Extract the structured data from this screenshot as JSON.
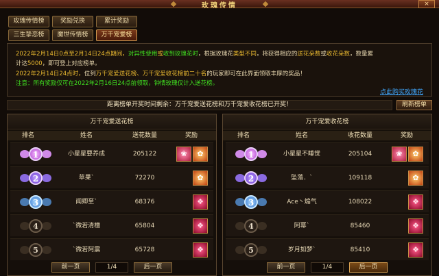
{
  "window": {
    "title": "玫瑰传情",
    "close_label": "×"
  },
  "tabs_main": [
    "玫瑰传情榜",
    "奖励兑换",
    "累计奖励"
  ],
  "tabs_sub": [
    "三生挚恋榜",
    "魔世传情榜",
    "万千宠爱榜"
  ],
  "info": {
    "line1": [
      {
        "t": "2022年2月14日0点至2月14日24点期间，",
        "c": "y"
      },
      {
        "t": "对异性使用",
        "c": "g"
      },
      {
        "t": "或",
        "c": "y"
      },
      {
        "t": "收到玫瑰花时",
        "c": "g"
      },
      {
        "t": "，根据玫瑰花",
        "c": "w"
      },
      {
        "t": "类型不同",
        "c": "y"
      },
      {
        "t": "，将获得相应的",
        "c": "w"
      },
      {
        "t": "送花朵数",
        "c": "y"
      },
      {
        "t": "或",
        "c": "w"
      },
      {
        "t": "收花朵数",
        "c": "y"
      },
      {
        "t": "，数量累",
        "c": "w"
      }
    ],
    "line2": [
      {
        "t": "计达",
        "c": "w"
      },
      {
        "t": "5000",
        "c": "y"
      },
      {
        "t": "，即可登上对应榜单。",
        "c": "w"
      }
    ],
    "line3": [
      {
        "t": "2022年2月14日24点时，",
        "c": "y"
      },
      {
        "t": "位列",
        "c": "w"
      },
      {
        "t": "万千宠爱送花榜、万千宠爱收花榜前二十名",
        "c": "y"
      },
      {
        "t": "的玩家即可在此界面领取丰厚的奖品！",
        "c": "w"
      }
    ],
    "line4": [
      {
        "t": "注意：所有奖励仅可在2022年2月16日24点前领取，钟情玫瑰仅计入送花榜。",
        "c": "g"
      }
    ],
    "buy_link": "点此购买玫瑰花"
  },
  "countdown": "距离榜单开奖时间剩余：万千宠爱送花榜和万千宠爱收花榜已开奖！",
  "refresh_label": "刷新榜单",
  "panels": [
    {
      "title": "万千宠爱送花榜",
      "headers": [
        "排名",
        "姓名",
        "送花数量",
        "奖励"
      ],
      "rows": [
        {
          "rank": "1",
          "name": "小星星要养成",
          "count": "205122",
          "rewards": [
            "rw-gift",
            "rw-rose"
          ]
        },
        {
          "rank": "2",
          "name": "苹果`",
          "count": "72270",
          "rewards": [
            "rw-rose"
          ]
        },
        {
          "rank": "3",
          "name": "闻卿至`",
          "count": "68376",
          "rewards": [
            "rw-box"
          ]
        },
        {
          "rank": "4",
          "name": "`微若清檀",
          "count": "65804",
          "rewards": [
            "rw-box"
          ]
        },
        {
          "rank": "5",
          "name": "`微若阿震",
          "count": "65728",
          "rewards": [
            "rw-box"
          ]
        }
      ],
      "pager": {
        "prev": "前一页",
        "page": "1/4",
        "next": "后一页"
      }
    },
    {
      "title": "万千宠爱收花榜",
      "headers": [
        "排名",
        "姓名",
        "收花数量",
        "奖励"
      ],
      "rows": [
        {
          "rank": "1",
          "name": "小星星不睡觉",
          "count": "205104",
          "rewards": [
            "rw-gift",
            "rw-rose"
          ]
        },
        {
          "rank": "2",
          "name": "坠落．`",
          "count": "109118",
          "rewards": [
            "rw-rose"
          ]
        },
        {
          "rank": "3",
          "name": "Ace丶煽气",
          "count": "108022",
          "rewards": [
            "rw-box"
          ]
        },
        {
          "rank": "4",
          "name": "阿幂`",
          "count": "85460",
          "rewards": [
            "rw-box"
          ]
        },
        {
          "rank": "5",
          "name": "岁月如梦`",
          "count": "85410",
          "rewards": [
            "rw-box"
          ]
        }
      ],
      "pager": {
        "prev": "前一页",
        "page": "1/4",
        "next": "后一页"
      }
    }
  ],
  "colors": {
    "yellow": "#e8b830",
    "green": "#40e020",
    "link": "#40a8ff"
  }
}
